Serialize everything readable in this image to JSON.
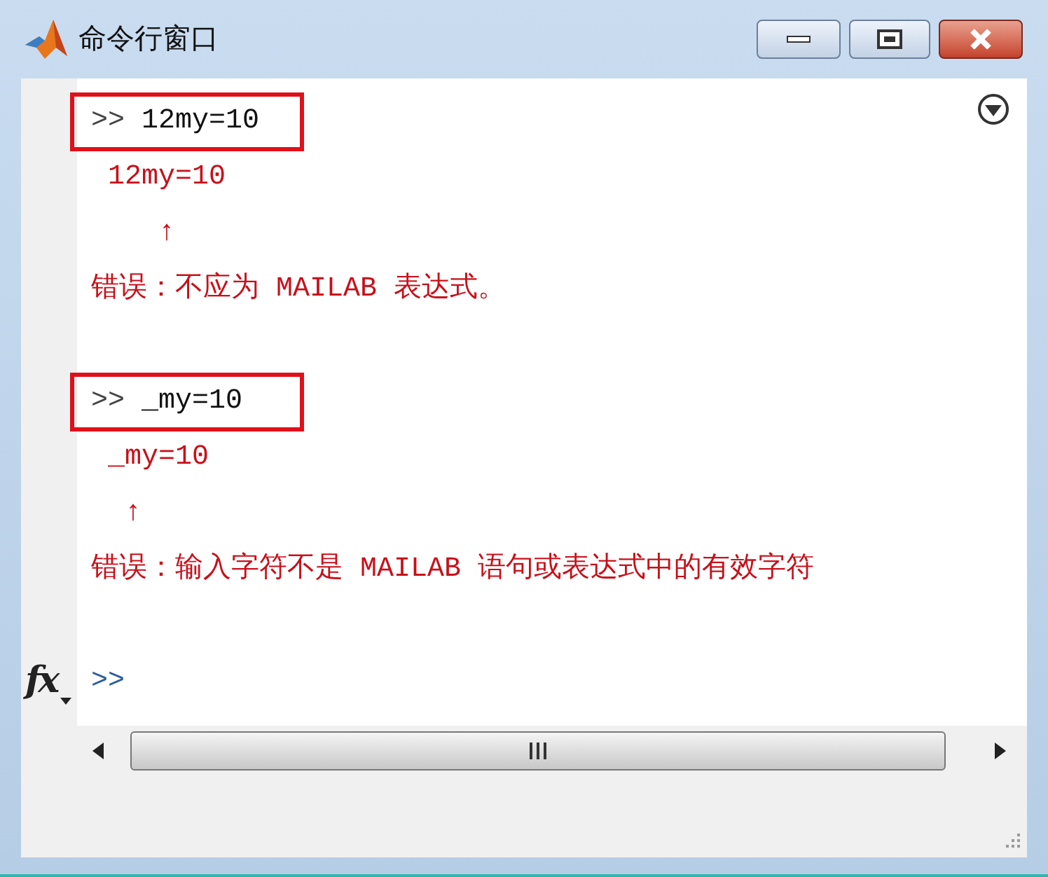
{
  "window": {
    "title": "命令行窗口"
  },
  "function_button": {
    "label": "fx"
  },
  "lines": [
    {
      "kind": "command",
      "prompt": ">>",
      "text": "12my=10"
    },
    {
      "kind": "echo",
      "text": " 12my=10"
    },
    {
      "kind": "caret",
      "text": "    ↑"
    },
    {
      "kind": "error",
      "text": "错误：不应为 MAILAB 表达式。"
    },
    {
      "kind": "blank"
    },
    {
      "kind": "command",
      "prompt": ">>",
      "text": "_my=10"
    },
    {
      "kind": "echo",
      "text": " _my=10"
    },
    {
      "kind": "caret",
      "text": "  ↑"
    },
    {
      "kind": "error",
      "text": "错误：输入字符不是 MAILAB 语句或表达式中的有效字符"
    },
    {
      "kind": "blank"
    },
    {
      "kind": "prompt",
      "prompt": ">>"
    }
  ]
}
